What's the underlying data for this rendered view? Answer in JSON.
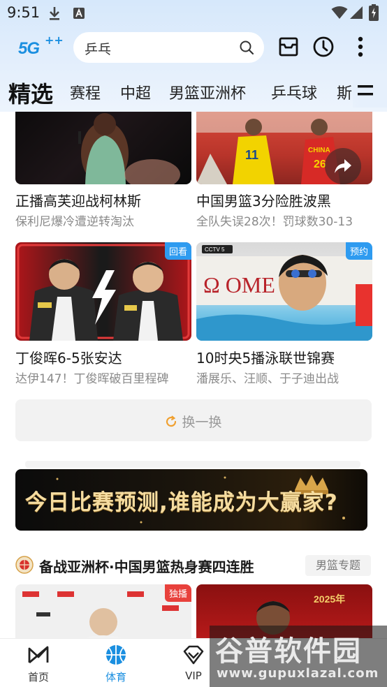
{
  "status_bar": {
    "time": "9:51",
    "icons": [
      "download-icon",
      "text-a-icon",
      "wifi-icon",
      "signal-icon",
      "battery-icon"
    ]
  },
  "header": {
    "logo_text": "5G",
    "logo_plus": "++",
    "search": {
      "value": "乒乓"
    },
    "icons": [
      "mailbox-icon",
      "history-clock-icon",
      "more-vertical-icon"
    ]
  },
  "nav": {
    "tabs": [
      {
        "label": "精选",
        "active": true
      },
      {
        "label": "赛程"
      },
      {
        "label": "中超"
      },
      {
        "label": "男篮亚洲杯"
      },
      {
        "label": "乒乓球"
      },
      {
        "label": "斯"
      }
    ],
    "menu_icon": "tab-menu-icon"
  },
  "cards": [
    {
      "title": "正播高芙迎战柯林斯",
      "subtitle": "保利尼爆冷遭逆转淘汰",
      "badge": ""
    },
    {
      "title": "中国男篮3分险胜波黑",
      "subtitle": "全队失误28次！罚球数30-13",
      "badge": ""
    },
    {
      "title": "丁俊晖6-5张安达",
      "subtitle": "达伊147！丁俊晖破百里程碑",
      "badge": "回看"
    },
    {
      "title": "10时央5播泳联世锦赛",
      "subtitle": "潘展乐、汪顺、于子迪出战",
      "badge": "预约"
    },
    {
      "title": "",
      "subtitle": "",
      "badge": "独播"
    },
    {
      "title": "",
      "subtitle": "",
      "badge": ""
    }
  ],
  "refresh_label": "换一换",
  "banner_text": "今日比赛预测,谁能成为大赢家?",
  "section": {
    "title": "备战亚洲杯·中国男篮热身赛四连胜",
    "tag": "男篮专题"
  },
  "image_text": {
    "scoreboard_label": "CCTV 5",
    "omega_text": "Ω OME",
    "jersey_numbers": [
      "11",
      "26"
    ],
    "jersey_text": "CHINA",
    "event_text": "2025年"
  },
  "bottom_nav": [
    {
      "label": "首页",
      "icon": "home-icon"
    },
    {
      "label": "体育",
      "icon": "basketball-icon",
      "active": true
    },
    {
      "label": "VIP",
      "icon": "vip-diamond-icon"
    }
  ],
  "watermark": {
    "main": "谷普软件园",
    "url": "www.gupuxlazal.com"
  },
  "colors": {
    "accent": "#1b8fe0",
    "badge_blue": "#2e9bf0",
    "badge_red": "#e8413c",
    "header_bg": "#dcebfc"
  }
}
